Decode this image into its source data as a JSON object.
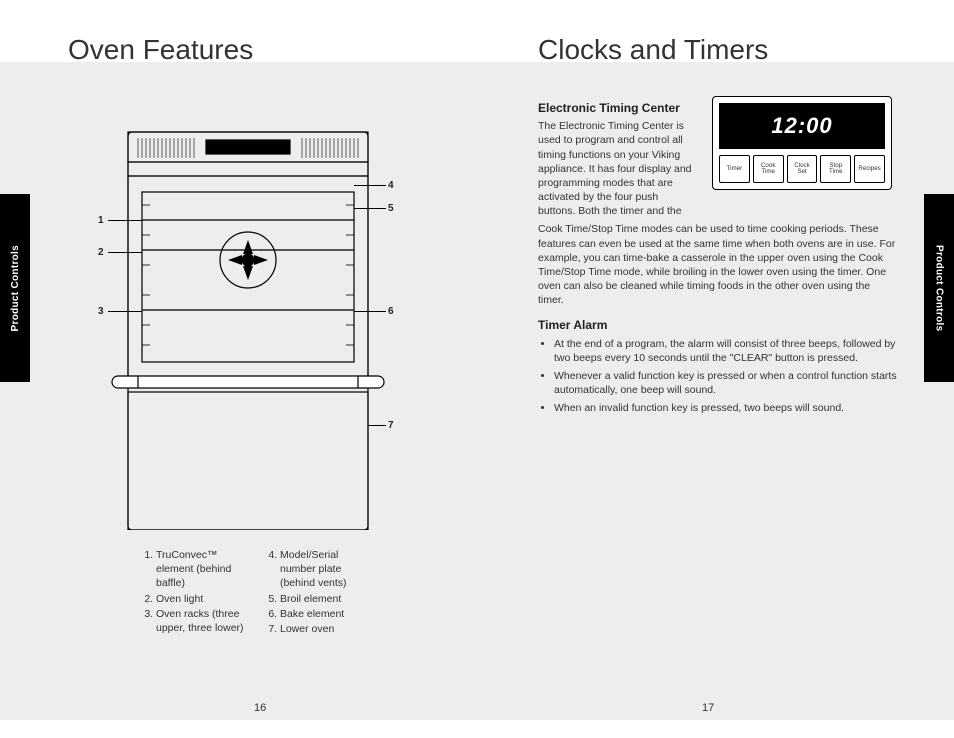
{
  "sideTabs": {
    "left": "Product Controls",
    "right": "Product Controls"
  },
  "leftPage": {
    "title": "Oven Features",
    "pageNum": "16",
    "callouts": {
      "c1": "1",
      "c2": "2",
      "c3": "3",
      "c4": "4",
      "c5": "5",
      "c6": "6",
      "c7": "7"
    },
    "legend": {
      "i1": "TruConvec™ element (behind baffle)",
      "i2": "Oven light",
      "i3": "Oven racks (three upper, three lower)",
      "i4": "Model/Serial number plate (behind vents)",
      "i5": "Broil element",
      "i6": "Bake element",
      "i7": "Lower oven"
    }
  },
  "rightPage": {
    "title": "Clocks and Timers",
    "pageNum": "17",
    "etc": {
      "heading": "Electronic Timing Center",
      "introCol": "The Electronic Timing Center is used to program and control all timing functions on your Viking appliance. It has four display and programming modes that are activated by the four push buttons. Both the timer and the",
      "introRest": "Cook Time/Stop Time modes can be used to time cooking periods. These features can even be used at the same time when both ovens are in use. For example, you can time-bake a casserole in the upper oven using the Cook Time/Stop Time mode, while broiling in the lower oven using the timer. One oven can also be cleaned while timing foods in the other oven using the timer."
    },
    "panel": {
      "time": "12:00",
      "b1": "Timer",
      "b2": "Cook\nTime",
      "b3": "Clock\nSet",
      "b4": "Stop\nTime",
      "b5": "Recipes"
    },
    "timer": {
      "heading": "Timer Alarm",
      "b1": "At the end of a program, the alarm will consist of three beeps, followed by two beeps every 10 seconds until the \"CLEAR\" button is pressed.",
      "b2": "Whenever a valid function key is pressed or when a control function starts automatically, one beep will sound.",
      "b3": "When an invalid function key is pressed, two beeps will sound."
    }
  }
}
